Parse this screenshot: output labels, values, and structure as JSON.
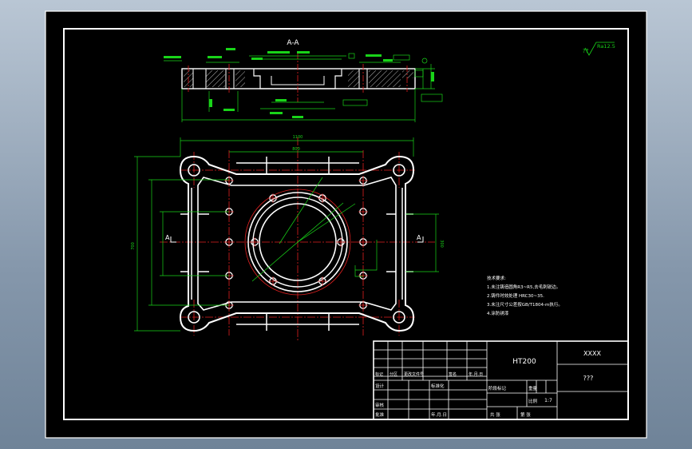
{
  "drawing": {
    "section_label": "A-A",
    "roughness_prefix": "??",
    "roughness_value": "Ra12.5",
    "section_marker_left": "A",
    "section_marker_right": "A",
    "dim_overall_width": "1100",
    "dim_hole_span": "800",
    "dim_height": "700",
    "dim_side": "300"
  },
  "notes": {
    "heading": "技术要求:",
    "line1": "1.未注铸造圆角R3~R5,去毛刺锐边。",
    "line2": "2.铸件时效处理 HRC30~35.",
    "line3": "3.未注尺寸公差按GB/T1804-m执行。",
    "line4": "4.涂防锈漆"
  },
  "title_block": {
    "material": "HT200",
    "company": "XXXX",
    "part_name": "???",
    "scale": "1:7",
    "designer": "设计",
    "reviewer": "审核",
    "approver": "批准",
    "standardizer": "标准化",
    "stage_mark": "阶段标记",
    "weight": "重量",
    "scale_label": "比例",
    "sheets_total": "共 张",
    "sheet_no": "第 张",
    "marker": "标记",
    "zone": "分区",
    "revision_file": "更改文件号",
    "signature": "签名",
    "date": "年.月.日"
  }
}
